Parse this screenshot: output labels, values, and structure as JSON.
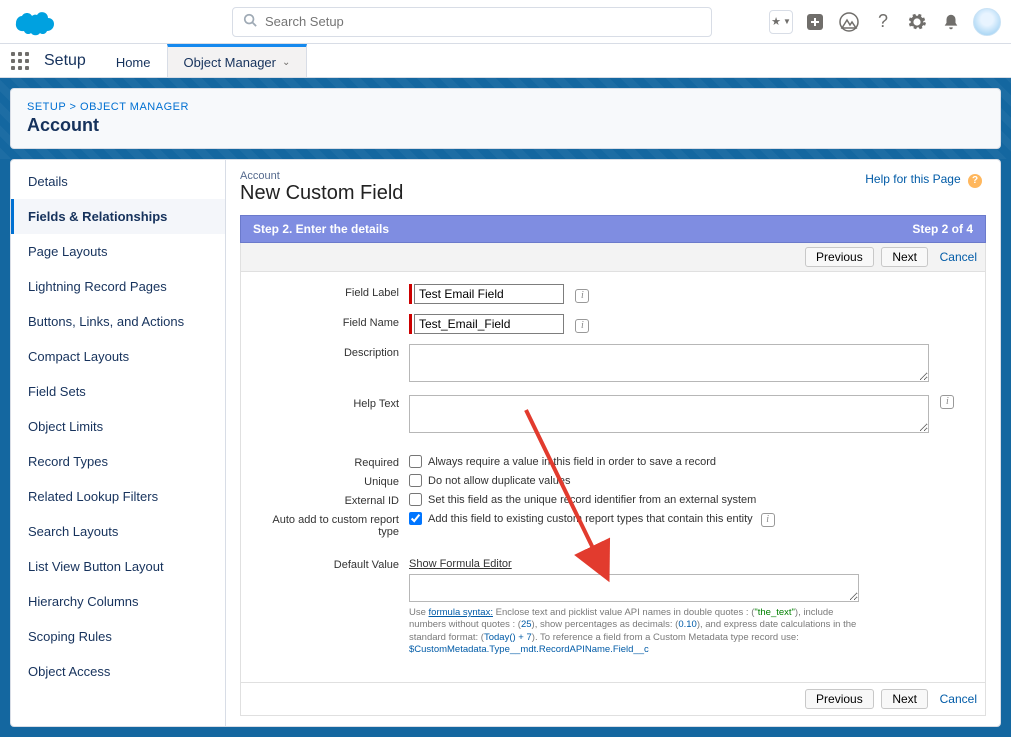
{
  "header": {
    "search_placeholder": "Search Setup"
  },
  "appnav": {
    "app_name": "Setup",
    "tabs": [
      "Home",
      "Object Manager"
    ]
  },
  "breadcrumb": {
    "a": "SETUP",
    "sep": ">",
    "b": "OBJECT MANAGER"
  },
  "page_title": "Account",
  "sidebar": {
    "items": [
      "Details",
      "Fields & Relationships",
      "Page Layouts",
      "Lightning Record Pages",
      "Buttons, Links, and Actions",
      "Compact Layouts",
      "Field Sets",
      "Object Limits",
      "Record Types",
      "Related Lookup Filters",
      "Search Layouts",
      "List View Button Layout",
      "Hierarchy Columns",
      "Scoping Rules",
      "Object Access"
    ]
  },
  "content": {
    "obj_label": "Account",
    "h1": "New Custom Field",
    "help_link": "Help for this Page",
    "step_title": "Step 2. Enter the details",
    "step_of": "Step 2 of 4",
    "buttons": {
      "prev": "Previous",
      "next": "Next",
      "cancel": "Cancel"
    },
    "fields": {
      "field_label_lbl": "Field Label",
      "field_label_val": "Test Email Field",
      "field_name_lbl": "Field Name",
      "field_name_val": "Test_Email_Field",
      "description_lbl": "Description",
      "help_text_lbl": "Help Text",
      "required_lbl": "Required",
      "required_txt": "Always require a value in this field in order to save a record",
      "unique_lbl": "Unique",
      "unique_txt": "Do not allow duplicate values",
      "external_lbl": "External ID",
      "external_txt": "Set this field as the unique record identifier from an external system",
      "autoadd_lbl": "Auto add to custom report type",
      "autoadd_txt": "Add this field to existing custom report types that contain this entity",
      "default_lbl": "Default Value",
      "formula_link": "Show Formula Editor",
      "hint_pre": "Use ",
      "hint_formula_syntax": "formula syntax:",
      "hint_mid1": " Enclose text and picklist value API names in double quotes : (",
      "hint_q1": "\"the_text\"",
      "hint_mid2": "), include numbers without quotes : (",
      "hint_q2": "25",
      "hint_mid3": "), show percentages as decimals: (",
      "hint_q3": "0.10",
      "hint_mid4": "), and express date calculations in the standard format: (",
      "hint_q4": "Today() + 7",
      "hint_mid5": "). To reference a field from a Custom Metadata type record use: ",
      "hint_q5": "$CustomMetadata.Type__mdt.RecordAPIName.Field__c"
    }
  }
}
